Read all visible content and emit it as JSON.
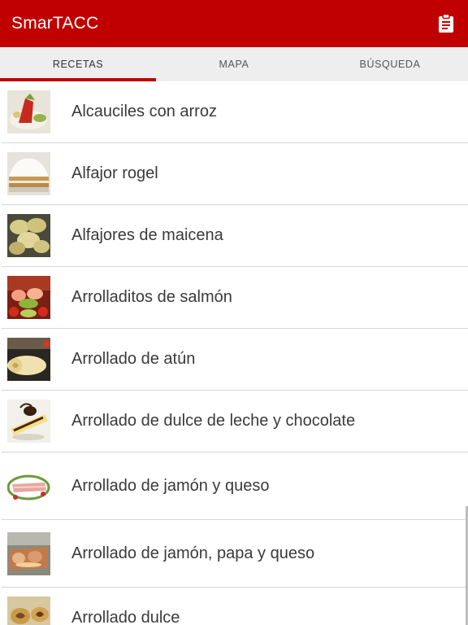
{
  "appbar": {
    "title": "SmarTACC",
    "action_icon": "clipboard-icon",
    "background_color": "#c00000"
  },
  "tabs": [
    {
      "label": "RECETAS",
      "active": true
    },
    {
      "label": "MAPA",
      "active": false
    },
    {
      "label": "BÚSQUEDA",
      "active": false
    }
  ],
  "recipes": [
    {
      "label": "Alcauciles con arroz",
      "thumbnail": "artichoke-rice-photo"
    },
    {
      "label": "Alfajor rogel",
      "thumbnail": "alfajor-rogel-photo"
    },
    {
      "label": "Alfajores de maicena",
      "thumbnail": "alfajores-maicena-photo"
    },
    {
      "label": "Arrolladitos de salmón",
      "thumbnail": "salmon-rolls-photo"
    },
    {
      "label": "Arrollado de atún",
      "thumbnail": "tuna-roll-photo"
    },
    {
      "label": "Arrollado de dulce de leche y chocolate",
      "thumbnail": "dulce-leche-roll-photo"
    },
    {
      "label": "Arrollado de jamón y queso",
      "thumbnail": "ham-cheese-roll-photo"
    },
    {
      "label": "Arrollado de jamón, papa y queso",
      "thumbnail": "ham-potato-roll-photo"
    },
    {
      "label": "Arrollado dulce",
      "thumbnail": "sweet-roll-photo"
    }
  ],
  "accent_color": "#c00000"
}
